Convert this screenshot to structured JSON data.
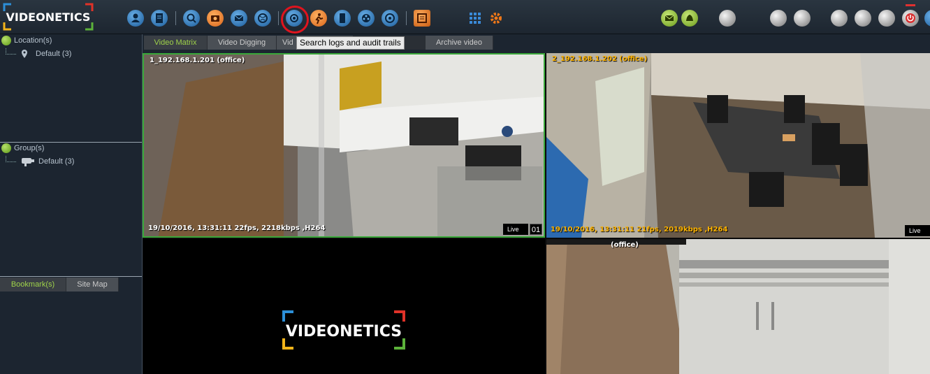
{
  "toolbar": {
    "logo_text": "VIDEONETICS",
    "tooltip": "Search logs and audit trails"
  },
  "sidebar": {
    "location_root": "Location(s)",
    "location_child": "Default (3)",
    "group_root": "Group(s)",
    "group_child": "Default (3)",
    "bottom_tabs": [
      "Bookmark(s)",
      "Site Map"
    ]
  },
  "main_tabs": [
    "Video Matrix",
    "Video Digging",
    "Vid",
    "",
    "Archive video"
  ],
  "cameras": [
    {
      "title": "1_192.168.1.201 (office)",
      "info": "19/10/2016, 13:31:11  22fps, 2218kbps ,H264",
      "live": "Live",
      "num": "01"
    },
    {
      "title": "2_192.168.1.202 (office)",
      "info": "19/10/2016, 13:31:11  21fps, 2019kbps ,H264",
      "live": "Live",
      "num": ""
    },
    {
      "title": "",
      "info": "",
      "live": "",
      "num": "",
      "placeholder_logo": "VIDEONETICS"
    },
    {
      "title": "(office)",
      "info": "",
      "live": "",
      "num": ""
    }
  ],
  "colors": {
    "accent_green": "#9fd24a",
    "highlight_red": "#e0141e",
    "overlay_orange": "#ffb400"
  },
  "icons": [
    "user-icon",
    "log-icon",
    "search-camera-icon",
    "snapshot-icon",
    "mail-icon",
    "globe-icon",
    "search-audit-icon",
    "run-icon",
    "mobile-icon",
    "film-icon",
    "settings-wheel-icon",
    "archive-icon",
    "grid-icon",
    "gear-icon",
    "mail-alert-icon",
    "bell-icon",
    "power-icon"
  ]
}
